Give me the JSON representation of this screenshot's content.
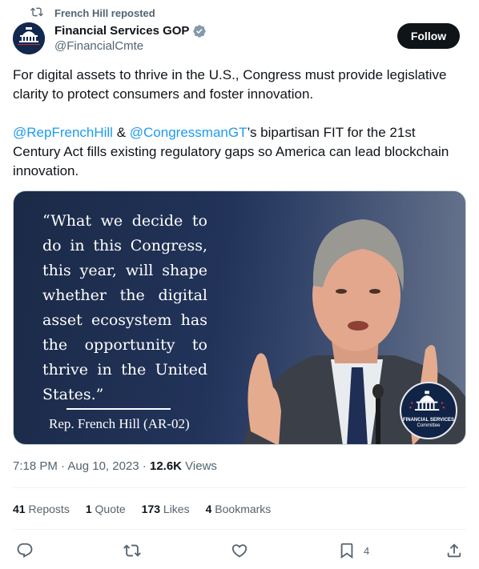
{
  "repost": {
    "icon": "repost-icon",
    "label": "French Hill reposted"
  },
  "author": {
    "display_name": "Financial Services GOP",
    "handle": "@FinancialCmte",
    "avatar_label": "FINANCIAL SERVICES Republicans",
    "verified_icon": "verified-badge-icon",
    "verified_color": "#829aab"
  },
  "follow_label": "Follow",
  "tweet": {
    "paragraph1": "For digital assets to thrive in the U.S., Congress must provide legislative clarity to protect consumers and foster innovation.",
    "mention1": "@RepFrenchHill",
    "amp": " & ",
    "mention2": "@CongressmanGT",
    "paragraph2_rest": "’s bipartisan FIT for the 21st Century Act fills existing regulatory gaps so America can lead blockchain innovation."
  },
  "media": {
    "quote": "“What we decide to do in this Congress, this year, will shape whether the digital asset ecosystem has the opportunity to thrive in the United States.”",
    "attribution": "Rep. French Hill (AR-02)",
    "seal_line1": "FINANCIAL SERVICES",
    "seal_line2": "Committee"
  },
  "meta": {
    "time": "7:18 PM",
    "sep": " · ",
    "date": "Aug 10, 2023",
    "views_count": "12.6K",
    "views_label": " Views"
  },
  "stats": {
    "reposts_count": "41",
    "reposts_label": " Reposts",
    "quotes_count": "1",
    "quotes_label": " Quote",
    "likes_count": "173",
    "likes_label": " Likes",
    "bookmarks_count": "4",
    "bookmarks_label": " Bookmarks"
  },
  "actions": {
    "reply_icon": "reply-icon",
    "repost_icon": "repost-icon",
    "like_icon": "heart-icon",
    "bookmark_icon": "bookmark-icon",
    "bookmark_count": "4",
    "share_icon": "share-icon"
  },
  "colors": {
    "link": "#1d9bf0",
    "muted": "#536471",
    "text": "#0f1419",
    "follow_bg": "#0f1419"
  }
}
